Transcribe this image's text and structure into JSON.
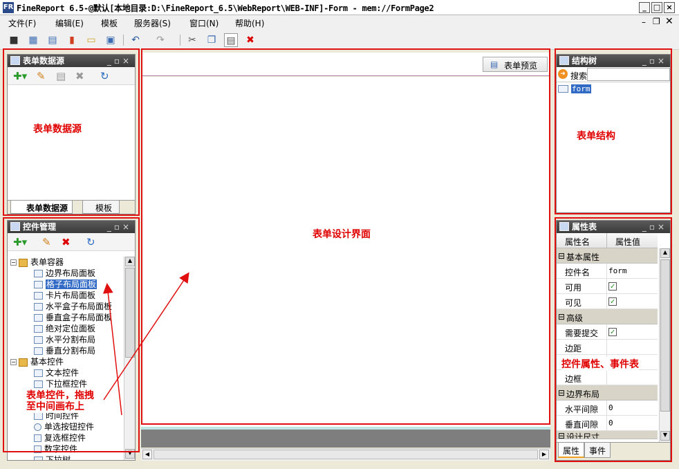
{
  "window": {
    "title": "FineReport 6.5-@默认[本地目录:D:\\FineReport_6.5\\WebReport\\WEB-INF]-Form - mem://FormPage2",
    "app_icon": "FR"
  },
  "menus": [
    "文件(F)",
    "编辑(E)",
    "模板",
    "服务器(S)",
    "窗口(N)",
    "帮助(H)"
  ],
  "datasource_panel": {
    "title": "表单数据源",
    "tabs": [
      "表单数据源",
      "模板"
    ],
    "annotation": "表单数据源"
  },
  "design": {
    "preview_label": "表单预览",
    "annotation": "表单设计界面"
  },
  "structure_panel": {
    "title": "结构树",
    "search_label": "搜索",
    "node": "form",
    "annotation": "表单结构"
  },
  "widget_panel": {
    "title": "控件管理",
    "groups": [
      {
        "label": "表单容器",
        "items": [
          "边界布局面板",
          "格子布局面板",
          "卡片布局面板",
          "水平盒子布局面板",
          "垂直盒子布局面板",
          "绝对定位面板",
          "水平分割布局",
          "垂直分割布局"
        ]
      },
      {
        "label": "基本控件",
        "items": [
          "文本控件",
          "下拉框控件"
        ]
      }
    ],
    "more_items": [
      "时间控件",
      "单选按钮控件",
      "复选框控件",
      "数字控件",
      "下拉树"
    ],
    "annotation_line1": "表单控件，拖拽",
    "annotation_line2": "至中间画布上"
  },
  "property_panel": {
    "title": "属性表",
    "col_name": "属性名",
    "col_value": "属性值",
    "cat_basic": "基本属性",
    "rows_basic": [
      {
        "k": "控件名",
        "v": "form"
      },
      {
        "k": "可用",
        "v": "✓"
      },
      {
        "k": "可见",
        "v": "✓"
      }
    ],
    "cat_adv": "高级",
    "rows_adv": [
      {
        "k": "需要提交",
        "v": "✓"
      },
      {
        "k": "边距",
        "v": ""
      },
      {
        "k": "",
        "v": ""
      },
      {
        "k": "边框",
        "v": ""
      }
    ],
    "cat_border": "边界布局",
    "rows_border": [
      {
        "k": "水平间隙",
        "v": "0"
      },
      {
        "k": "垂直间隙",
        "v": "0"
      }
    ],
    "cat_size": "设计尺寸",
    "tabs": [
      "属性",
      "事件"
    ],
    "annotation": "控件属性、事件表"
  }
}
